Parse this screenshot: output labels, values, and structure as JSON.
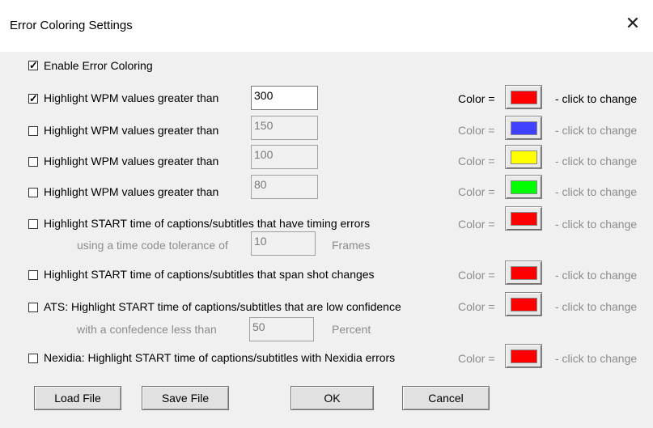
{
  "window": {
    "title": "Error Coloring Settings",
    "close_glyph": "✕"
  },
  "enable": {
    "label": "Enable Error Coloring",
    "checked": true
  },
  "rows": [
    {
      "label": "Highlight WPM values greater than",
      "checked": true,
      "value": "300",
      "color": "#ff0000"
    },
    {
      "label": "Highlight WPM values greater than",
      "checked": false,
      "value": "150",
      "color": "#4040ff"
    },
    {
      "label": "Highlight WPM values greater than",
      "checked": false,
      "value": "100",
      "color": "#ffff00"
    },
    {
      "label": "Highlight WPM values greater than",
      "checked": false,
      "value": "80",
      "color": "#00ff00"
    },
    {
      "label": "Highlight START time of captions/subtitles that have timing errors",
      "checked": false,
      "color": "#ff0000"
    },
    {
      "label": "Highlight START time of captions/subtitles that span shot changes",
      "checked": false,
      "color": "#ff0000"
    },
    {
      "label": "ATS: Highlight START time of captions/subtitles that are low confidence",
      "checked": false,
      "color": "#ff0000"
    },
    {
      "label": "Nexidia: Highlight START time of captions/subtitles with Nexidia errors",
      "checked": false,
      "color": "#ff0000"
    }
  ],
  "color_label": "Color =",
  "click_hint": "- click to change",
  "tolerance": {
    "prefix": "using a time code tolerance of",
    "value": "10",
    "suffix": "Frames"
  },
  "confidence": {
    "prefix": "with a confedence less than",
    "value": "50",
    "suffix": "Percent"
  },
  "buttons": {
    "load": "Load File",
    "save": "Save File",
    "ok": "OK",
    "cancel": "Cancel"
  },
  "check_glyph": "✓",
  "icons": {
    "close": "close-icon",
    "check": "checkmark-icon"
  }
}
